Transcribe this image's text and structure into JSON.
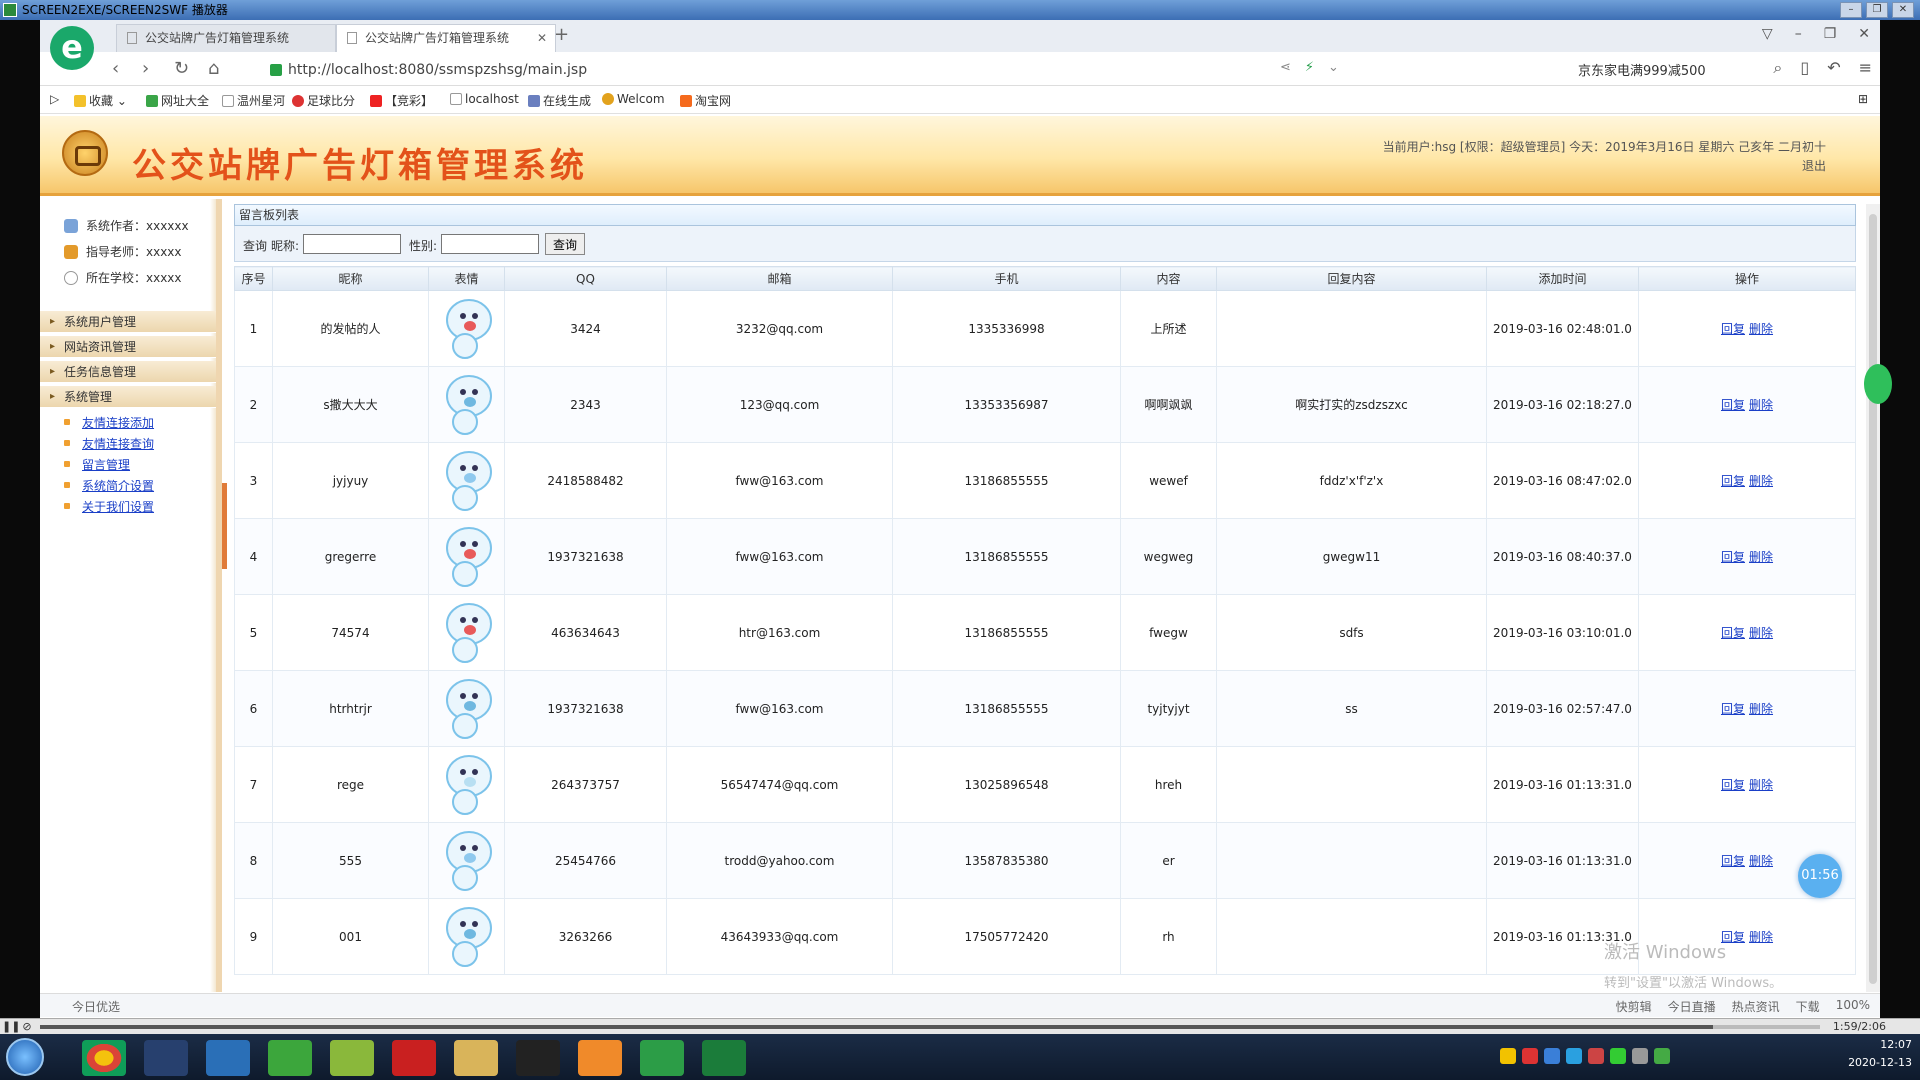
{
  "player": {
    "title": "SCREEN2EXE/SCREEN2SWF 播放器",
    "time": "1:59/2:06",
    "progress": 0.94
  },
  "browser": {
    "tabs": [
      {
        "label": "公交站牌广告灯箱管理系统"
      },
      {
        "label": "公交站牌广告灯箱管理系统"
      }
    ],
    "url": "http://localhost:8080/ssmspzshsg/main.jsp",
    "search_text": "京东家电满999减500",
    "bookmarks": [
      "收藏",
      "网址大全",
      "温州星河",
      "足球比分",
      "【竞彩】",
      "localhost",
      "在线生成",
      "Welcom",
      "淘宝网"
    ],
    "status_left": "今日优选",
    "status_right": [
      "快剪辑",
      "今日直播",
      "热点资讯",
      "下载",
      "100%"
    ]
  },
  "header": {
    "title": "公交站牌广告灯箱管理系统",
    "user_info": "当前用户:hsg [权限：超级管理员] 今天：2019年3月16日 星期六 己亥年 二月初十",
    "logout": "退出"
  },
  "sidebar": {
    "info": [
      {
        "label": "系统作者：xxxxxx"
      },
      {
        "label": "指导老师：xxxxx"
      },
      {
        "label": "所在学校：xxxxx"
      }
    ],
    "menus": [
      "系统用户管理",
      "网站资讯管理",
      "任务信息管理",
      "系统管理"
    ],
    "submenu": [
      "友情连接添加",
      "友情连接查询",
      "留言管理",
      "系统简介设置",
      "关于我们设置"
    ]
  },
  "panel": {
    "title": "留言板列表",
    "query_label": "查询",
    "nickname_label": "昵称:",
    "gender_label": "性别:",
    "query_button": "查询"
  },
  "table": {
    "headers": [
      "序号",
      "昵称",
      "表情",
      "QQ",
      "邮箱",
      "手机",
      "内容",
      "回复内容",
      "添加时间",
      "操作"
    ],
    "reply_label": "回复",
    "delete_label": "删除",
    "rows": [
      {
        "no": "1",
        "nick": "的发帖的人",
        "qq": "3424",
        "email": "3232@qq.com",
        "phone": "1335336998",
        "content": "上所述",
        "reply": "",
        "time": "2019-03-16 02:48:01.0"
      },
      {
        "no": "2",
        "nick": "s撒大大大",
        "qq": "2343",
        "email": "123@qq.com",
        "phone": "13353356987",
        "content": "啊啊飒飒",
        "reply": "啊实打实的zsdzszxc",
        "time": "2019-03-16 02:18:27.0"
      },
      {
        "no": "3",
        "nick": "jyjyuy",
        "qq": "2418588482",
        "email": "fww@163.com",
        "phone": "13186855555",
        "content": "wewef",
        "reply": "fddz'x'f'z'x",
        "time": "2019-03-16 08:47:02.0"
      },
      {
        "no": "4",
        "nick": "gregerre",
        "qq": "1937321638",
        "email": "fww@163.com",
        "phone": "13186855555",
        "content": "wegweg",
        "reply": "gwegw11",
        "time": "2019-03-16 08:40:37.0"
      },
      {
        "no": "5",
        "nick": "74574",
        "qq": "463634643",
        "email": "htr@163.com",
        "phone": "13186855555",
        "content": "fwegw",
        "reply": "sdfs",
        "time": "2019-03-16 03:10:01.0"
      },
      {
        "no": "6",
        "nick": "htrhtrjr",
        "qq": "1937321638",
        "email": "fww@163.com",
        "phone": "13186855555",
        "content": "tyjtyjyt",
        "reply": "ss",
        "time": "2019-03-16 02:57:47.0"
      },
      {
        "no": "7",
        "nick": "rege",
        "qq": "264373757",
        "email": "56547474@qq.com",
        "phone": "13025896548",
        "content": "hreh",
        "reply": "",
        "time": "2019-03-16 01:13:31.0"
      },
      {
        "no": "8",
        "nick": "555",
        "qq": "25454766",
        "email": "trodd@yahoo.com",
        "phone": "13587835380",
        "content": "er",
        "reply": "",
        "time": "2019-03-16 01:13:31.0"
      },
      {
        "no": "9",
        "nick": "001",
        "qq": "3263266",
        "email": "43643933@qq.com",
        "phone": "17505772420",
        "content": "rh",
        "reply": "",
        "time": "2019-03-16 01:13:31.0"
      }
    ]
  },
  "overlay": {
    "timer": "01:56",
    "watermark1": "激活 Windows",
    "watermark2": "转到\"设置\"以激活 Windows。"
  },
  "taskbar": {
    "time": "12:07",
    "date": "2020-12-13"
  },
  "colors": {
    "title_orange": "#e3521a",
    "link_blue": "#1a3fc7",
    "header_bg": "#ffe7a8"
  }
}
